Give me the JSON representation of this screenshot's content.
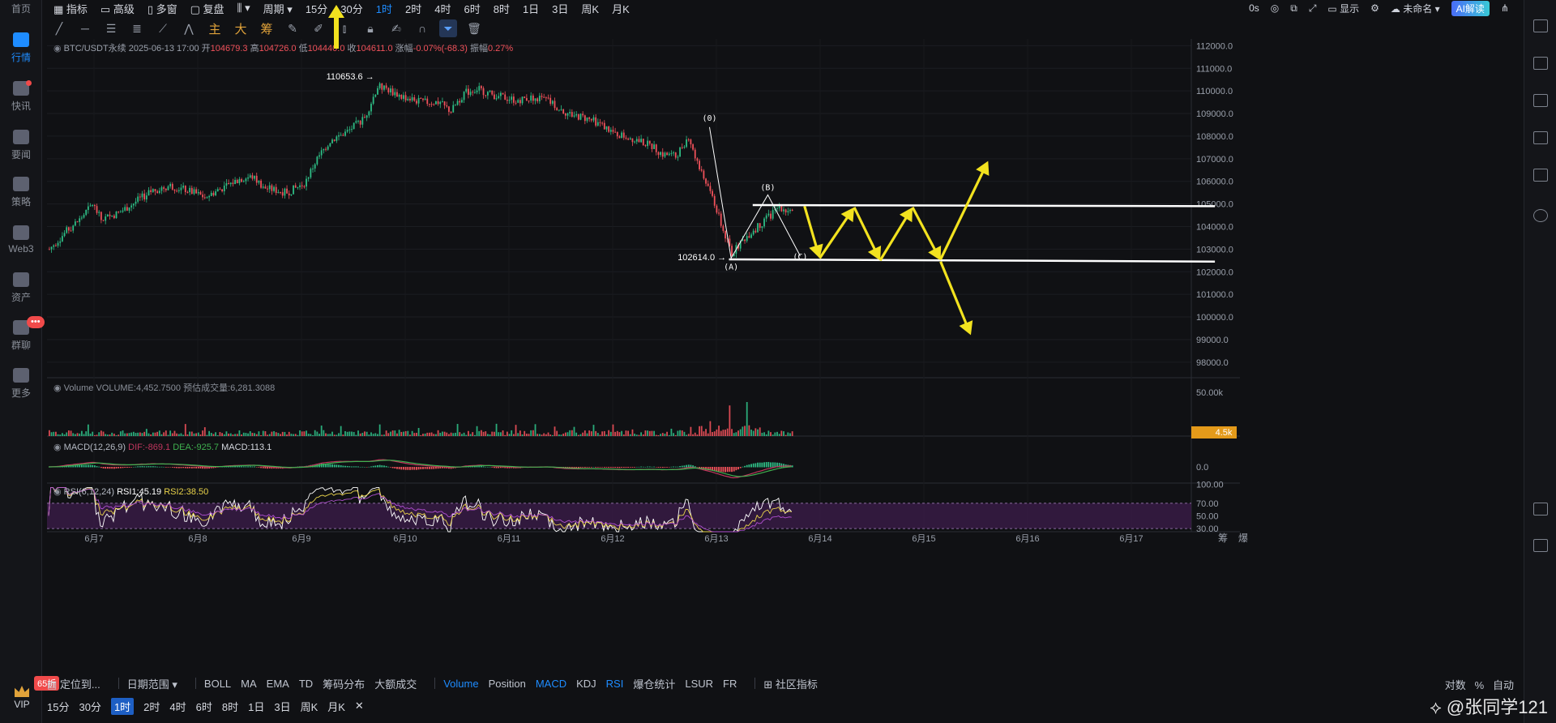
{
  "leftnav": {
    "top": "首页",
    "items": [
      {
        "label": "行情",
        "active": true
      },
      {
        "label": "快讯"
      },
      {
        "label": "要闻"
      },
      {
        "label": "策略"
      },
      {
        "label": "Web3"
      },
      {
        "label": "资产"
      },
      {
        "label": "群聊",
        "badge": "•••"
      },
      {
        "label": "更多"
      }
    ],
    "vip": "VIP",
    "promo": "65折"
  },
  "topbar": {
    "items": [
      "指标",
      "高级",
      "多窗",
      "复盘",
      "周期",
      "15分",
      "30分",
      "1时",
      "2时",
      "4时",
      "6时",
      "8时",
      "1日",
      "3日",
      "周K",
      "月K"
    ],
    "active": "1时",
    "right": [
      "0s",
      "显示",
      "未命名",
      "AI解读"
    ]
  },
  "toolbar": {
    "cn": [
      "主",
      "大",
      "筹"
    ]
  },
  "legend": {
    "symbol": "BTC/USDT永续",
    "time": "2025-06-13 17:00",
    "open_label": "开",
    "open": "104679.3",
    "high_label": "高",
    "high": "104726.0",
    "low_label": "低",
    "low": "104440.0",
    "close_label": "收",
    "close": "104611.0",
    "change_label": "涨幅",
    "change": "-0.07%(-68.3)",
    "amp_label": "振幅",
    "amp": "0.27%"
  },
  "volume_legend": {
    "title": "Volume",
    "text": "VOLUME:4,452.7500",
    "est": "预估成交量:6,281.3088",
    "axis": "50.00k",
    "badge": "4.5k"
  },
  "macd_legend": {
    "title": "MACD(12,26,9)",
    "dif": "DIF:-869.1",
    "dea": "DEA:-925.7",
    "macd": "MACD:113.1",
    "axis": "0.0"
  },
  "rsi_legend": {
    "title": "RSI(6,12,24)",
    "rsi1": "RSI1:45.19",
    "rsi2": "RSI2:38.50",
    "axis": [
      "100.00",
      "70.00",
      "50.00",
      "30.00"
    ]
  },
  "annotations": {
    "high": "110653.6",
    "low": "102614.0",
    "wave0": "(0)",
    "waveA": "(A)",
    "waveB": "(B)",
    "waveC": "(C)"
  },
  "chart_data": {
    "type": "candlestick",
    "price_axis": [
      "112000.0",
      "111000.0",
      "110000.0",
      "109000.0",
      "108000.0",
      "107000.0",
      "106000.0",
      "105000.0",
      "104000.0",
      "103000.0",
      "102000.0",
      "101000.0",
      "100000.0",
      "99000.0",
      "98000.0"
    ],
    "ylim": [
      97600,
      112300
    ],
    "x_labels": [
      "6月7",
      "6月8",
      "6月9",
      "6月10",
      "6月11",
      "6月12",
      "6月13",
      "6月14",
      "6月15",
      "6月16",
      "6月17"
    ],
    "x_right": [
      "筹",
      "爆"
    ]
  },
  "bottom": {
    "left": [
      "定位到...",
      "日期范围"
    ],
    "indicators": [
      "BOLL",
      "MA",
      "EMA",
      "TD",
      "筹码分布",
      "大额成交",
      "Volume",
      "Position",
      "MACD",
      "KDJ",
      "RSI",
      "爆仓统计",
      "LSUR",
      "FR"
    ],
    "active_indicators": [
      "Volume",
      "MACD",
      "RSI"
    ],
    "community": "社区指标",
    "right": [
      "对数",
      "%",
      "自动"
    ],
    "periods": [
      "15分",
      "30分",
      "1时",
      "2时",
      "4时",
      "6时",
      "8时",
      "1日",
      "3日",
      "周K",
      "月K"
    ],
    "active_period": "1时"
  },
  "watermark": "张同学121"
}
